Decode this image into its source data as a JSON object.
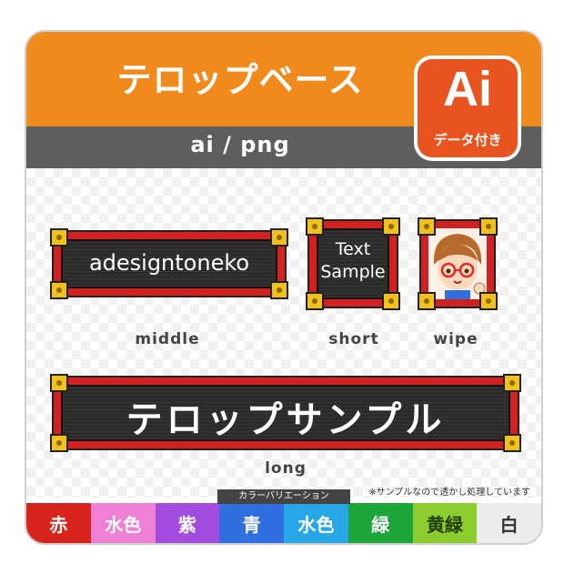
{
  "header": {
    "title": "テロップベース",
    "subtitle": "ai / png"
  },
  "badge": {
    "big": "Ai",
    "small": "データ付き"
  },
  "telops": {
    "middle": {
      "text": "adesigntoneko",
      "label": "middle"
    },
    "short": {
      "line1": "Text",
      "line2": "Sample",
      "label": "short"
    },
    "wipe": {
      "label": "wipe"
    },
    "long": {
      "text": "テロップサンプル",
      "label": "long"
    }
  },
  "note": "※サンプルなので透かし処理しています",
  "variations_label": "カラーバリエーション",
  "colors": [
    {
      "label": "赤",
      "bg": "#d8231c",
      "fg": "#ffffff"
    },
    {
      "label": "水色",
      "bg": "#f07fd6",
      "fg": "#ffffff"
    },
    {
      "label": "紫",
      "bg": "#a24ce0",
      "fg": "#ffffff"
    },
    {
      "label": "青",
      "bg": "#2f6fe0",
      "fg": "#ffffff"
    },
    {
      "label": "水色",
      "bg": "#27a7e8",
      "fg": "#ffffff"
    },
    {
      "label": "緑",
      "bg": "#1ca63a",
      "fg": "#ffffff"
    },
    {
      "label": "黄緑",
      "bg": "#8ccc2e",
      "fg": "#1f3d00"
    },
    {
      "label": "白",
      "bg": "#ececec",
      "fg": "#333333"
    }
  ]
}
